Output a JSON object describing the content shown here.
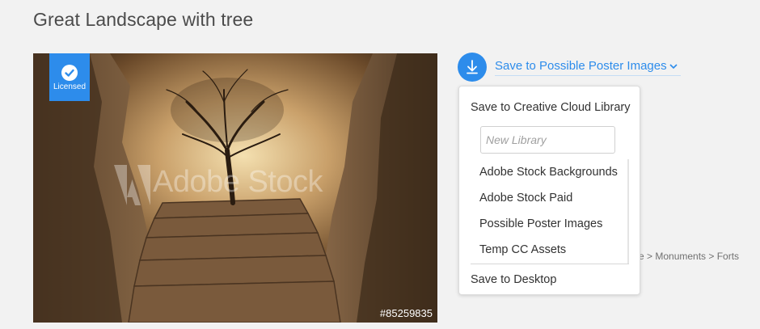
{
  "page": {
    "title": "Great Landscape with tree"
  },
  "image": {
    "badge_label": "Licensed",
    "watermark": "Adobe Stock",
    "asset_id": "#85259835"
  },
  "save": {
    "label": "Save to Possible Poster Images",
    "icon": "download-icon",
    "accent_color": "#2d8ceb"
  },
  "dropdown": {
    "header": "Save to Creative Cloud Library",
    "new_library_placeholder": "New Library",
    "new_library_value": "",
    "libraries": [
      "Adobe Stock Backgrounds",
      "Adobe Stock Paid",
      "Possible Poster Images",
      "Temp CC Assets"
    ],
    "desktop_label": "Save to Desktop"
  },
  "breadcrumb": {
    "text": "re > Monuments > Forts"
  }
}
